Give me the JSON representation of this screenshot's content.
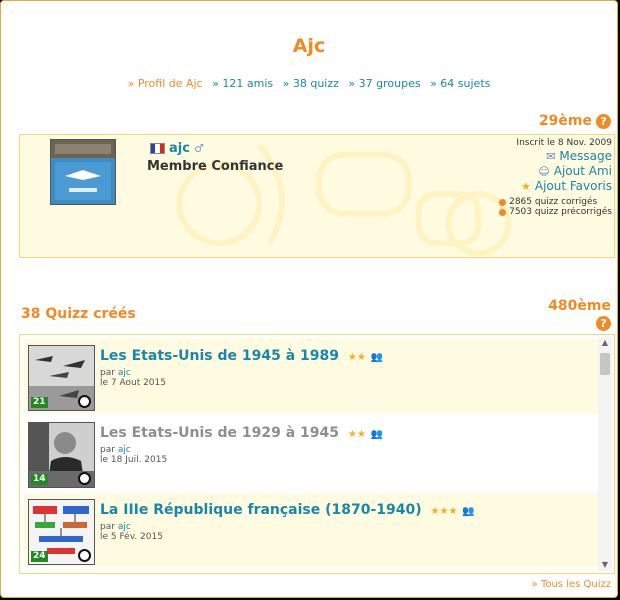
{
  "page": {
    "title": "Ajc"
  },
  "nav": {
    "profile": "» Profil de Ajc",
    "friends": "» 121 amis",
    "quizz": "» 38 quizz",
    "groups": "» 37 groupes",
    "topics": "» 64 sujets"
  },
  "profile": {
    "rank": "29ème",
    "username": "ajc",
    "role": "Membre Confiance",
    "since": "Inscrit le 8 Nov. 2009",
    "actions": {
      "message": "Message",
      "add_friend": "Ajout Ami",
      "add_fav": "Ajout Favoris"
    },
    "stats": {
      "corrected": "2865 quizz corrigés",
      "precorrected": "7503 quizz précorrigés"
    }
  },
  "quizzes": {
    "title": "38 Quizz créés",
    "rank": "480ème",
    "items": [
      {
        "title": "Les Etats-Unis de 1945 à 1989",
        "by_prefix": "par",
        "author": "ajc",
        "date": "le 7 Aout 2015",
        "count": "21",
        "stars": "★★"
      },
      {
        "title": "Les Etats-Unis de 1929 à 1945",
        "by_prefix": "par",
        "author": "ajc",
        "date": "le 18 Juil. 2015",
        "count": "14",
        "stars": "★★"
      },
      {
        "title": "La IIIe République française (1870-1940)",
        "by_prefix": "par",
        "author": "ajc",
        "date": "le 5 Fév. 2015",
        "count": "24",
        "stars": "★★★"
      }
    ],
    "all_link": "» Tous les Quizz"
  },
  "icons": {
    "help": "?",
    "sb_up": "▲",
    "sb_down": "▼"
  },
  "colors": {
    "accent": "#f08a24",
    "link": "#1a86a8",
    "highlight": "#fffbe1"
  }
}
